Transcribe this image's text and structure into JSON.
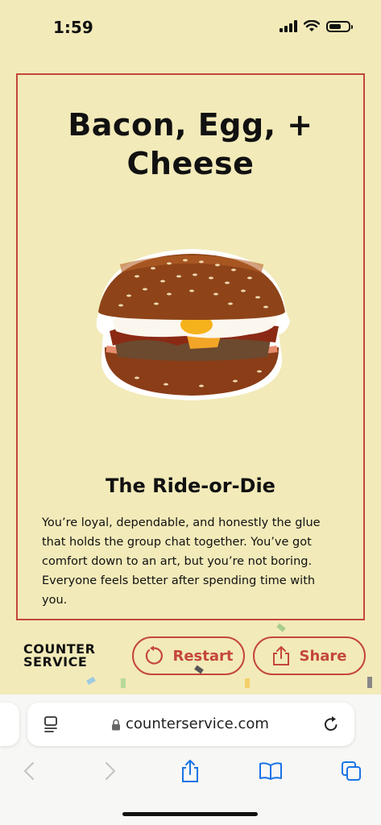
{
  "status": {
    "time": "1:59"
  },
  "card": {
    "title": "Bacon, Egg, + Cheese",
    "result_name": "The Ride-or-Die",
    "description": "You’re loyal, dependable, and honestly the glue that holds the group chat together. You’ve got comfort down to an art, but you’re not boring. Everyone feels better after spending time with you."
  },
  "footer": {
    "logo_line1": "COUNTER",
    "logo_line2": "SERVICE",
    "restart_label": "Restart",
    "share_label": "Share"
  },
  "browser": {
    "url": "counterservice.com"
  },
  "colors": {
    "accent": "#c4473a",
    "background": "#f2eab9"
  },
  "icons": [
    "signal-icon",
    "wifi-icon",
    "battery-icon",
    "restart-icon",
    "share-icon",
    "tab-settings-icon",
    "lock-icon",
    "reload-icon",
    "back-icon",
    "forward-icon",
    "share-sheet-icon",
    "bookmarks-icon",
    "tabs-icon"
  ]
}
